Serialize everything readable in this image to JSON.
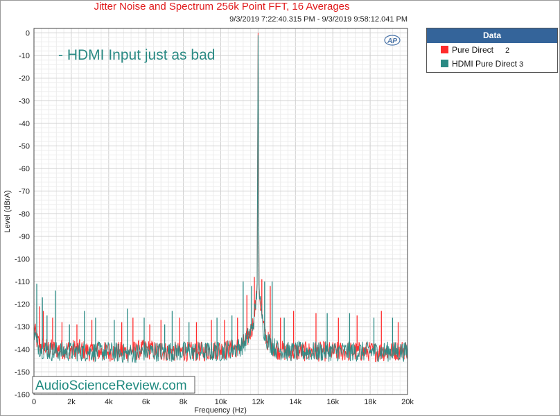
{
  "chart_data": {
    "type": "line",
    "title": "Jitter Noise and Spectrum 256k Point FFT, 16 Averages",
    "subtitle": "9/3/2019 7:22:40.315 PM - 9/3/2019 9:58:12.041 PM",
    "xlabel": "Frequency (Hz)",
    "ylabel": "Level (dBrA)",
    "xlim": [
      0,
      20000
    ],
    "ylim": [
      -160,
      2
    ],
    "x_ticks": [
      0,
      2000,
      4000,
      6000,
      8000,
      10000,
      12000,
      14000,
      16000,
      18000,
      20000
    ],
    "x_tick_labels": [
      "0",
      "2k",
      "4k",
      "6k",
      "8k",
      "10k",
      "12k",
      "14k",
      "16k",
      "18k",
      "20k"
    ],
    "y_ticks": [
      0,
      -10,
      -20,
      -30,
      -40,
      -50,
      -60,
      -70,
      -80,
      -90,
      -100,
      -110,
      -120,
      -130,
      -140,
      -150,
      -160
    ],
    "y_tick_labels": [
      "0",
      "-10",
      "-20",
      "-30",
      "-40",
      "-50",
      "-60",
      "-70",
      "-80",
      "-90",
      "-100",
      "-110",
      "-120",
      "-130",
      "-140",
      "-150",
      "-160"
    ],
    "grid": true,
    "legend_position": "right",
    "annotation": "- HDMI Input just as bad",
    "watermark": "AudioScienceReview.com",
    "logo": "AP",
    "series": [
      {
        "name": "Pure Direct",
        "label_number": "2",
        "color": "#ff2b2b",
        "x": [
          0,
          150,
          300,
          500,
          1000,
          1500,
          2000,
          2500,
          3000,
          4000,
          5000,
          6000,
          7000,
          8000,
          9000,
          10000,
          10500,
          11000,
          11300,
          11500,
          11700,
          11800,
          11900,
          11950,
          12000,
          12050,
          12100,
          12200,
          12300,
          12500,
          12700,
          13000,
          13500,
          14000,
          15000,
          16000,
          17000,
          18000,
          19000,
          20000
        ],
        "y": [
          -130,
          -136,
          -138,
          -139,
          -140,
          -140,
          -140,
          -140,
          -141,
          -141,
          -141,
          -140,
          -141,
          -141,
          -141,
          -140,
          -140,
          -139,
          -137,
          -134,
          -130,
          -125,
          -118,
          -110,
          0,
          -110,
          -118,
          -125,
          -131,
          -136,
          -138,
          -140,
          -141,
          -141,
          -141,
          -141,
          -141,
          -141,
          -141,
          -140
        ],
        "spurs_x": [
          300,
          500,
          1000,
          1500,
          2300,
          3100,
          4700,
          5300,
          6200,
          6800,
          7800,
          8700,
          9500,
          10200,
          10900,
          11400,
          11800,
          12200,
          12650,
          13200,
          13900,
          15100,
          16300,
          17300,
          18600,
          19500
        ],
        "spurs_y": [
          -121,
          -123,
          -126,
          -128,
          -129,
          -127,
          -128,
          -126,
          -129,
          -127,
          -126,
          -128,
          -127,
          -127,
          -126,
          -116,
          -108,
          -109,
          -112,
          -126,
          -123,
          -124,
          -126,
          -125,
          -123,
          -128
        ]
      },
      {
        "name": "HDMI Pure Direct",
        "label_number": "3",
        "color": "#2b8a84",
        "x": [
          0,
          150,
          300,
          500,
          1000,
          1500,
          2000,
          2500,
          3000,
          4000,
          5000,
          6000,
          7000,
          8000,
          9000,
          10000,
          10500,
          11000,
          11300,
          11500,
          11700,
          11800,
          11900,
          11950,
          12000,
          12050,
          12100,
          12200,
          12300,
          12500,
          12700,
          13000,
          13500,
          14000,
          15000,
          16000,
          17000,
          18000,
          19000,
          20000
        ],
        "y": [
          -132,
          -137,
          -139,
          -140,
          -141,
          -141,
          -141,
          -141,
          -141,
          -141,
          -142,
          -141,
          -141,
          -141,
          -141,
          -141,
          -140,
          -139,
          -137,
          -134,
          -130,
          -125,
          -118,
          -111,
          -1,
          -111,
          -118,
          -125,
          -131,
          -136,
          -138,
          -140,
          -141,
          -141,
          -141,
          -141,
          -141,
          -141,
          -141,
          -141
        ],
        "spurs_x": [
          150,
          450,
          700,
          1150,
          1900,
          2700,
          3300,
          4300,
          5000,
          5900,
          7000,
          7400,
          8300,
          9800,
          10600,
          11200,
          11650,
          12350,
          12750,
          13400,
          15700,
          16900,
          18200,
          19200
        ],
        "spurs_y": [
          -111,
          -117,
          -125,
          -114,
          -129,
          -123,
          -126,
          -127,
          -122,
          -126,
          -129,
          -123,
          -128,
          -126,
          -125,
          -110,
          -112,
          -110,
          -110,
          -126,
          -124,
          -124,
          -126,
          -126
        ]
      }
    ]
  },
  "legend": {
    "header": "Data"
  }
}
